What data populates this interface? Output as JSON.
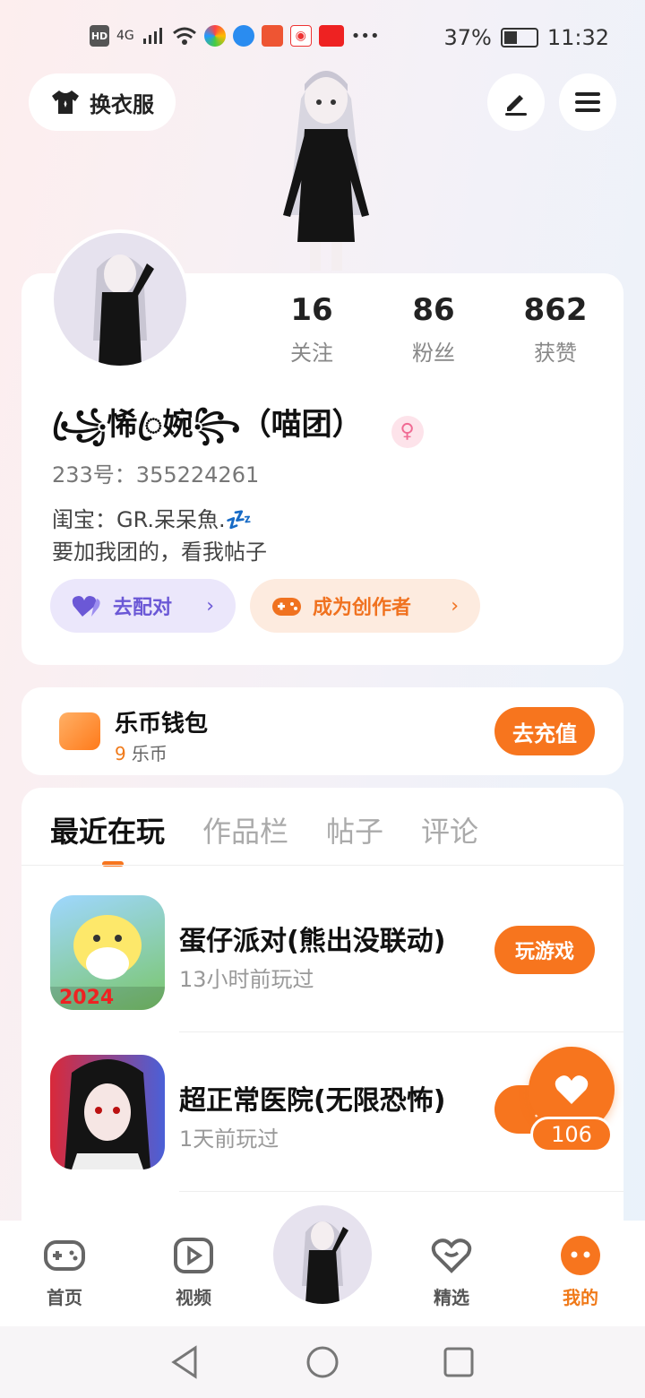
{
  "status_bar": {
    "battery": "37%",
    "time": "11:32",
    "network": "4G",
    "hd": "HD"
  },
  "header": {
    "outfit_label": "换衣服"
  },
  "profile": {
    "stats": [
      {
        "value": "16",
        "label": "关注"
      },
      {
        "value": "86",
        "label": "粉丝"
      },
      {
        "value": "862",
        "label": "获赞"
      }
    ],
    "nickname": "꧁ꦿ悕ꦿ婉꧂（喵团）",
    "gender_symbol": "♀",
    "uid": "233号：355224261",
    "bio_line1": "闺宝：GR.呆呆魚.💤",
    "bio_line2": "要加我团的，看我帖子",
    "match_label": "去配对",
    "creator_label": "成为创作者"
  },
  "wallet": {
    "title": "乐币钱包",
    "amount": "9",
    "unit": "乐币",
    "recharge_label": "去充值"
  },
  "tabs": {
    "items": [
      "最近在玩",
      "作品栏",
      "帖子",
      "评论"
    ]
  },
  "games": [
    {
      "title": "蛋仔派对(熊出没联动)",
      "time": "13小时前玩过",
      "action": "玩游戏",
      "badge": "2024"
    },
    {
      "title": "超正常医院(无限恐怖)",
      "time": "1天前玩过",
      "action": "玩"
    }
  ],
  "float_like": {
    "count": "106"
  },
  "bottom_nav": {
    "items": [
      {
        "label": "首页"
      },
      {
        "label": "视频"
      },
      {
        "label": "精选"
      },
      {
        "label": "我的"
      }
    ]
  },
  "colors": {
    "accent": "#f7751e",
    "match": "#6b58d6",
    "pink": "#f06a93"
  }
}
